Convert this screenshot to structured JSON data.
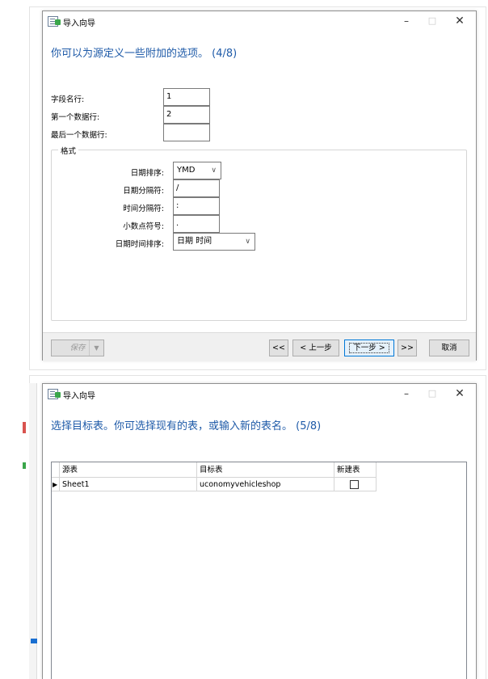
{
  "wizard1": {
    "title": "导入向导",
    "window_controls": {
      "minimize": "–",
      "maximize": "□",
      "close": "✕"
    },
    "heading": "你可以为源定义一些附加的选项。 (4/8)",
    "fields": {
      "field_name_row_label": "字段名行:",
      "field_name_row_value": "1",
      "first_data_row_label": "第一个数据行:",
      "first_data_row_value": "2",
      "last_data_row_label": "最后一个数据行:",
      "last_data_row_value": ""
    },
    "format_group": {
      "legend": "格式",
      "date_order_label": "日期排序:",
      "date_order_value": "YMD",
      "date_delimiter_label": "日期分隔符:",
      "date_delimiter_value": "/",
      "time_delimiter_label": "时间分隔符:",
      "time_delimiter_value": ":",
      "decimal_symbol_label": "小数点符号:",
      "decimal_symbol_value": ".",
      "datetime_order_label": "日期时间排序:",
      "datetime_order_value": "日期 时间"
    },
    "footer": {
      "save": "保存",
      "first": "<<",
      "prev": "< 上一步",
      "next": "下一步 >",
      "last": ">>",
      "cancel": "取消"
    }
  },
  "wizard2": {
    "title": "导入向导",
    "window_controls": {
      "minimize": "–",
      "maximize": "□",
      "close": "✕"
    },
    "heading": "选择目标表。你可选择现有的表，或输入新的表名。 (5/8)",
    "table": {
      "columns": [
        "源表",
        "目标表",
        "新建表"
      ],
      "rows": [
        {
          "indicator": "▶",
          "source": "Sheet1",
          "target": "uconomyvehicleshop",
          "new_table": false
        }
      ]
    }
  },
  "colors": {
    "heading": "#1e5aa8",
    "focus_border": "#0078d7"
  }
}
